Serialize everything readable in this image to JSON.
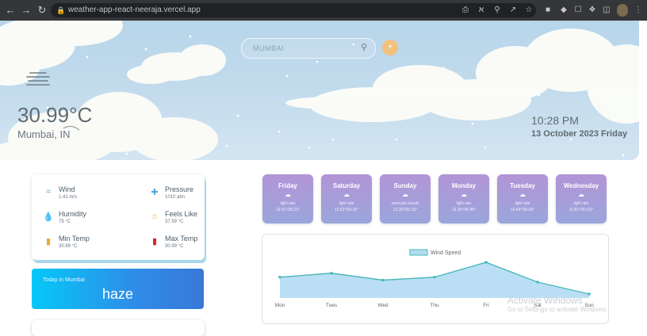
{
  "browser": {
    "url": "weather-app-react-neeraja.vercel.app",
    "icons": [
      "back-icon",
      "forward-icon",
      "reload-icon",
      "lock-icon",
      "screenshot-icon",
      "translate-icon",
      "zoom-icon",
      "share-icon",
      "star-icon",
      "extension-icon",
      "profile-icon",
      "menu-icon"
    ]
  },
  "search": {
    "placeholder": "MUMBAI",
    "location_button_label": "+"
  },
  "current": {
    "temperature": "30.99°C",
    "location": "Mumbai, IN",
    "time": "10:28 PM",
    "date": "13 October 2023 Friday",
    "condition_icon": "haze-icon"
  },
  "details": {
    "wind": {
      "label": "Wind",
      "value": "1.41 m/s"
    },
    "pressure": {
      "label": "Pressure",
      "value": "1010 atm"
    },
    "humidity": {
      "label": "Humidity",
      "value": "79 °C"
    },
    "feels_like": {
      "label": "Feels Like",
      "value": "37.59 °C"
    },
    "min_temp": {
      "label": "Min Temp",
      "value": "30.99 °C"
    },
    "max_temp": {
      "label": "Max Temp",
      "value": "30.99 °C"
    }
  },
  "today": {
    "label": "Today in Mumbai",
    "condition": "haze"
  },
  "forecast": [
    {
      "day": "Friday",
      "desc": "light rain",
      "temps": "13.51°/30.23°"
    },
    {
      "day": "Saturday",
      "desc": "light rain",
      "temps": "13.51°/30.25°"
    },
    {
      "day": "Sunday",
      "desc": "overcast clouds",
      "temps": "13.26°/30.33°"
    },
    {
      "day": "Monday",
      "desc": "light rain",
      "temps": "13.25°/30.49°"
    },
    {
      "day": "Tuesday",
      "desc": "light rain",
      "temps": "13.64°/30.69°"
    },
    {
      "day": "Wednesday",
      "desc": "light rain",
      "temps": "11.81°/30.63°"
    }
  ],
  "chart_data": {
    "type": "area",
    "categories": [
      "Mon",
      "Tues",
      "Wed",
      "Thu",
      "Fri",
      "Sat",
      "Sun"
    ],
    "series": [
      {
        "name": "Wind Speed",
        "values": [
          2.1,
          2.5,
          1.8,
          2.1,
          3.6,
          1.6,
          0.4
        ]
      }
    ],
    "ylim": [
      0,
      4
    ],
    "grid": false,
    "legend": "top-center",
    "colors": {
      "line": "#4bb8b8",
      "fill": "#b3dcf3"
    }
  },
  "watermark": {
    "title": "Activate Windows",
    "subtitle": "Go to Settings to activate Windows."
  }
}
